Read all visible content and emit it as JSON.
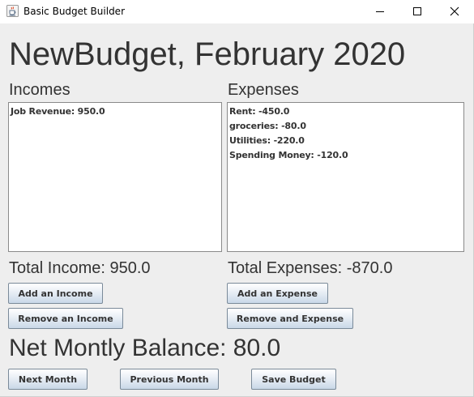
{
  "window": {
    "title": "Basic Budget Builder",
    "icons": {
      "app": "java-cup-icon",
      "minimize": "minimize-icon",
      "maximize": "maximize-icon",
      "close": "close-icon"
    }
  },
  "budget": {
    "heading": "NewBudget, February 2020"
  },
  "incomes": {
    "label": "Incomes",
    "items": [
      "Job Revenue: 950.0"
    ],
    "total": "Total Income: 950.0",
    "add_button": "Add an Income",
    "remove_button": "Remove an Income"
  },
  "expenses": {
    "label": "Expenses",
    "items": [
      "Rent: -450.0",
      "groceries: -80.0",
      "Utilities: -220.0",
      "Spending Money: -120.0"
    ],
    "total": "Total Expenses: -870.0",
    "add_button": "Add an Expense",
    "remove_button": "Remove and Expense"
  },
  "net": {
    "label": "Net Montly Balance: 80.0"
  },
  "footer": {
    "next_button": "Next Month",
    "previous_button": "Previous Month",
    "save_button": "Save Budget"
  }
}
